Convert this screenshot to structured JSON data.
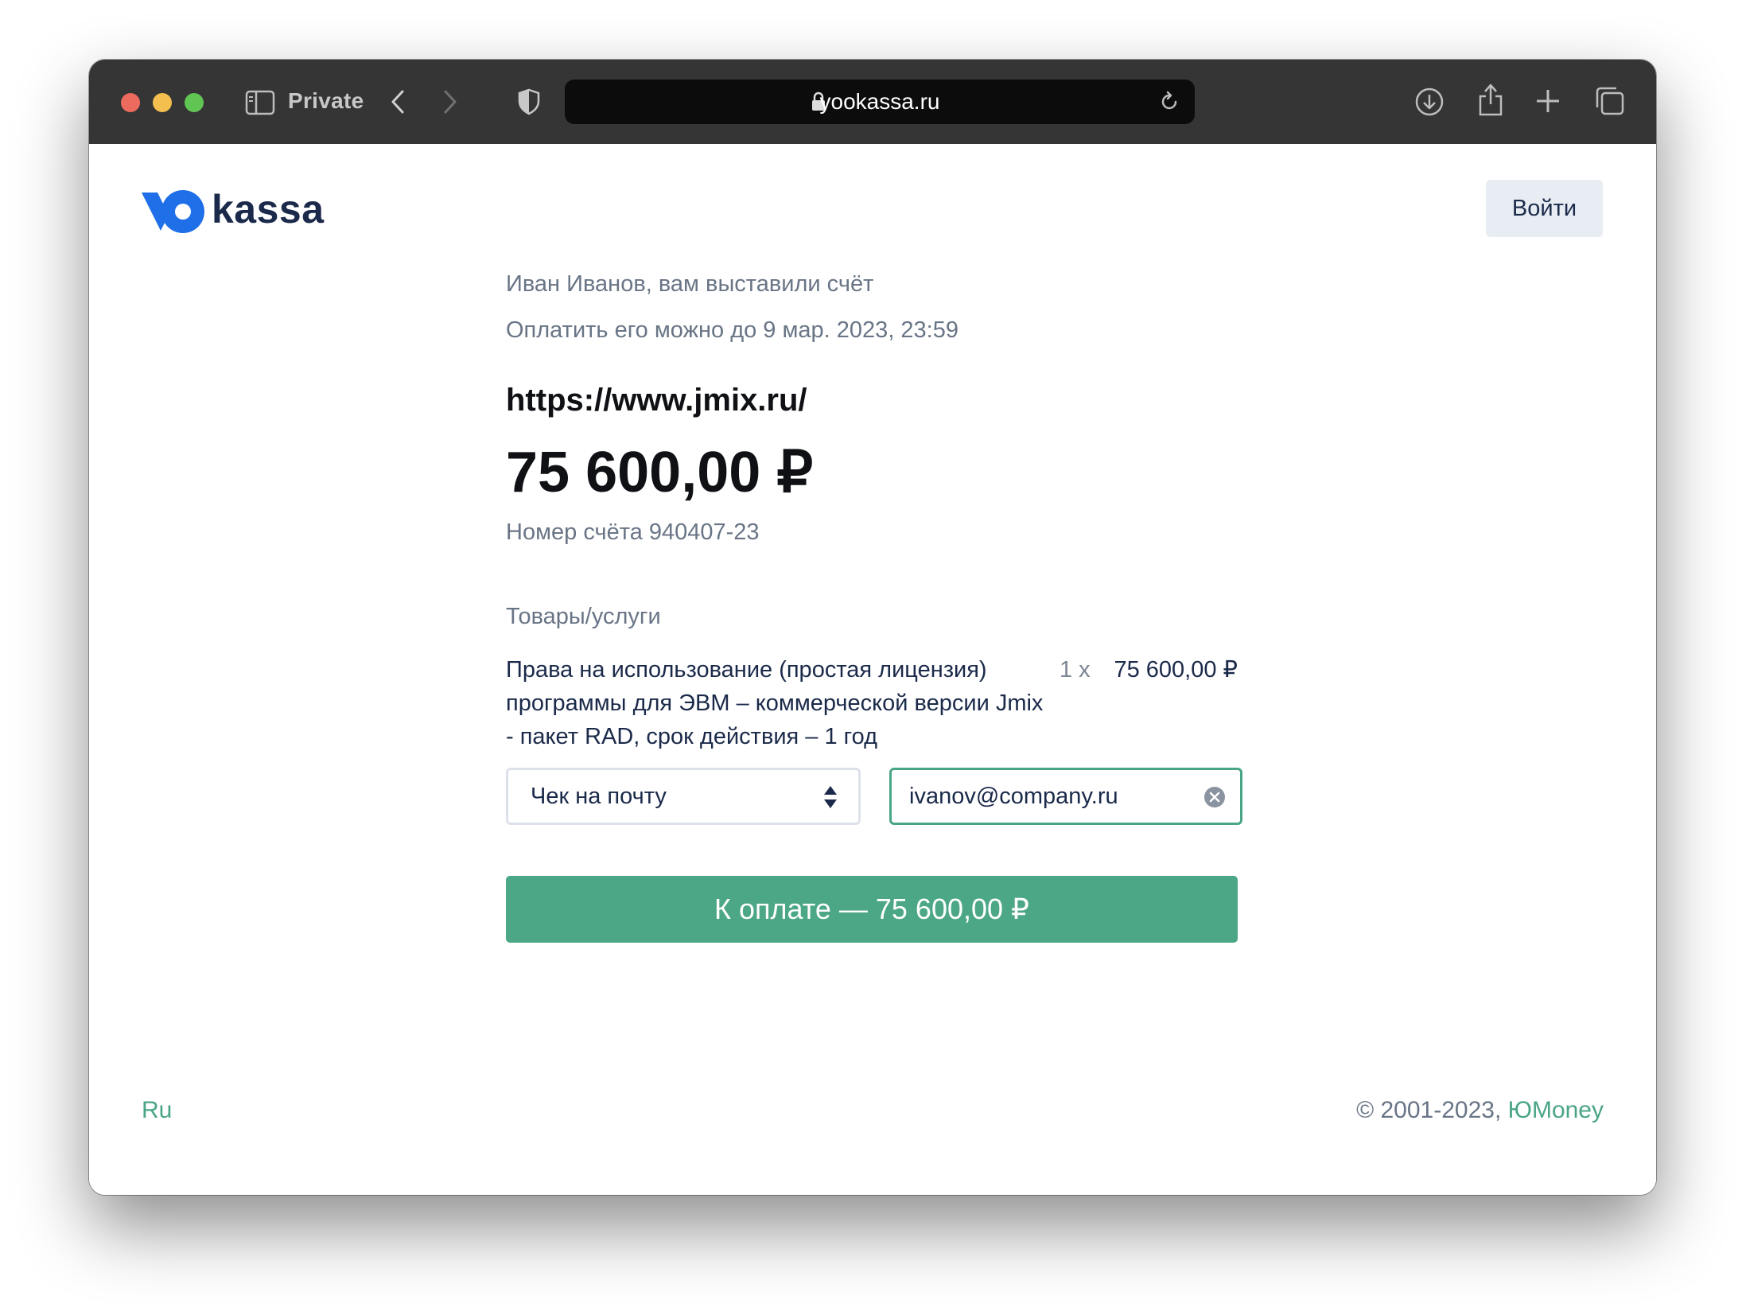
{
  "browser": {
    "private_label": "Private",
    "url": "yookassa.ru"
  },
  "header": {
    "logo_text": "kassa",
    "login_label": "Войти"
  },
  "invoice": {
    "greeting": "Иван Иванов, вам выставили счёт",
    "deadline": "Оплатить его можно до 9 мар. 2023, 23:59",
    "merchant": "https://www.jmix.ru/",
    "amount": "75 600,00 ₽",
    "invoice_number": "Номер счёта 940407-23",
    "goods_title": "Товары/услуги",
    "items": [
      {
        "name": "Права на использование (простая лицензия) программы для ЭВМ – коммерческой версии Jmix - пакет RAD, срок действия – 1 год",
        "qty": "1 x",
        "price": "75 600,00 ₽"
      }
    ]
  },
  "receipt": {
    "method": "Чек на почту",
    "email": "ivanov@company.ru"
  },
  "pay_button_label": "К оплате — 75 600,00 ₽",
  "footer": {
    "language": "Ru",
    "copyright": "© 2001-2023, ",
    "brand_link": "ЮMoney"
  },
  "colors": {
    "accent_green": "#4ba786",
    "brand_blue": "#1f6fe8",
    "text_dark": "#1b2a4a",
    "text_muted": "#697586"
  }
}
